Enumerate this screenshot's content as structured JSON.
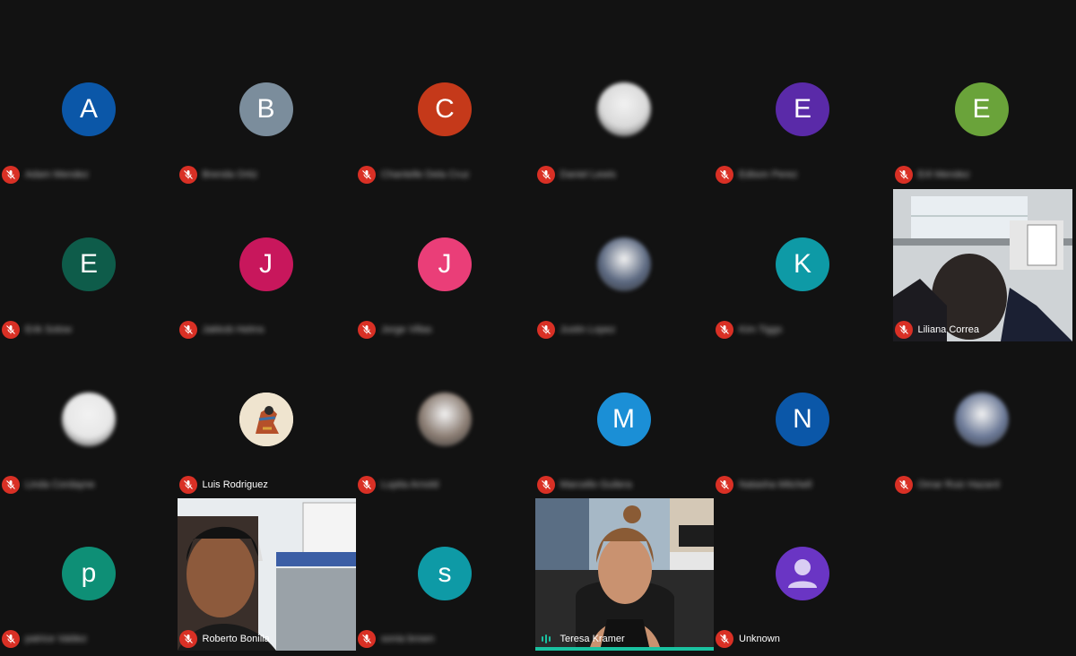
{
  "participants": [
    {
      "initial": "A",
      "color": "#0b57a8",
      "name": "Adam Mendez",
      "name_visible": false,
      "type": "initial"
    },
    {
      "initial": "B",
      "color": "#7b8d9c",
      "name": "Brenda Ortiz",
      "name_visible": false,
      "type": "initial"
    },
    {
      "initial": "C",
      "color": "#c5391a",
      "name": "Chantelle Dela Cruz",
      "name_visible": false,
      "type": "initial"
    },
    {
      "initial": "",
      "color": "#d9d9d9",
      "name": "Daniel Lewis",
      "name_visible": false,
      "type": "photo"
    },
    {
      "initial": "E",
      "color": "#5a2aa8",
      "name": "Edison Perez",
      "name_visible": false,
      "type": "initial"
    },
    {
      "initial": "E",
      "color": "#6aa33a",
      "name": "Erli Mendez",
      "name_visible": false,
      "type": "initial"
    },
    {
      "initial": "E",
      "color": "#0e5c4a",
      "name": "Erik Solow",
      "name_visible": false,
      "type": "initial"
    },
    {
      "initial": "J",
      "color": "#c8175c",
      "name": "Jakkob Helms",
      "name_visible": false,
      "type": "initial"
    },
    {
      "initial": "J",
      "color": "#ea3e78",
      "name": "Jorge Villas",
      "name_visible": false,
      "type": "initial"
    },
    {
      "initial": "",
      "color": "#5b6880",
      "name": "Justin Lopez",
      "name_visible": false,
      "type": "photo"
    },
    {
      "initial": "K",
      "color": "#0e9aa6",
      "name": "Kim Tiggs",
      "name_visible": false,
      "type": "initial"
    },
    {
      "initial": "",
      "color": "#cfcfcf",
      "name": "Liliana Correa",
      "name_visible": true,
      "type": "video"
    },
    {
      "initial": "",
      "color": "#e7e7e7",
      "name": "Linda Cordayne",
      "name_visible": false,
      "type": "photo"
    },
    {
      "initial": "",
      "color": "#e8dcc3",
      "name": "Luis Rodriguez",
      "name_visible": true,
      "type": "art"
    },
    {
      "initial": "",
      "color": "#8a7c72",
      "name": "Lupita Arnold",
      "name_visible": false,
      "type": "photo"
    },
    {
      "initial": "M",
      "color": "#1b8fd6",
      "name": "Marcello Guilera",
      "name_visible": false,
      "type": "initial"
    },
    {
      "initial": "N",
      "color": "#0b57a8",
      "name": "Natasha Mitchell",
      "name_visible": false,
      "type": "initial"
    },
    {
      "initial": "",
      "color": "#6a7896",
      "name": "Omar Ruiz Hazard",
      "name_visible": false,
      "type": "photo"
    },
    {
      "initial": "p",
      "color": "#0e8f76",
      "name": "patrice Valdez",
      "name_visible": false,
      "type": "initial"
    },
    {
      "initial": "",
      "color": "#c9d6e0",
      "name": "Roberto Bonilla",
      "name_visible": true,
      "type": "video"
    },
    {
      "initial": "s",
      "color": "#0e9aa6",
      "name": "sonia brown",
      "name_visible": false,
      "type": "initial"
    },
    {
      "initial": "",
      "color": "#8aa3b8",
      "name": "Teresa Kramer",
      "name_visible": true,
      "type": "video",
      "speaking": true
    },
    {
      "initial": "",
      "color": "#6a35c4",
      "name": "Unknown",
      "name_visible": true,
      "type": "unknown"
    }
  ],
  "colors": {
    "background": "#121212",
    "mic_muted": "#d93025",
    "speaking_accent": "#1ac1a0"
  },
  "icons": {
    "mic_off": "mic-off-icon",
    "speaking": "audio-level-icon",
    "unknown_avatar": "person-icon"
  }
}
